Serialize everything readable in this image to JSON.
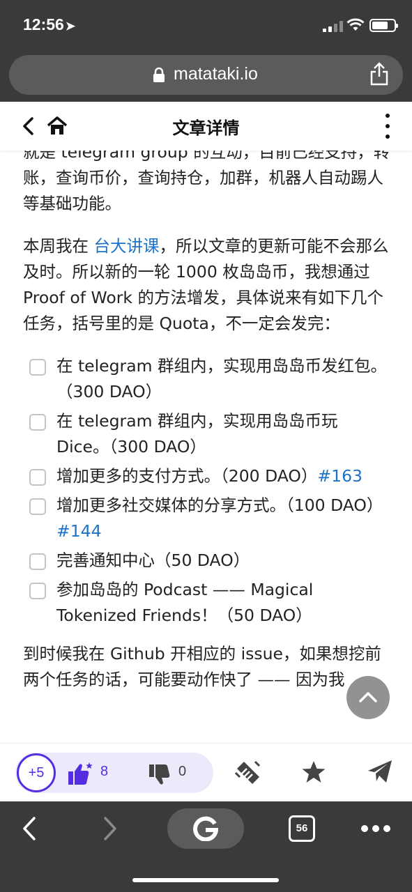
{
  "status_bar": {
    "time": "12:56",
    "location_arrow": "location-arrow-icon"
  },
  "browser": {
    "url": "matataki.io",
    "tab_count": "56",
    "search_engine_icon": "google-g-icon"
  },
  "header": {
    "title": "文章详情"
  },
  "article": {
    "p1": "就是 telegram group 的互动，目前已经支持，转账，查询币价，查询持仓，加群，机器人自动踢人等基础功能。",
    "p2_prefix": "本周我在 ",
    "p2_link": "台大讲课",
    "p2_suffix": "，所以文章的更新可能不会那么及时。所以新的一轮 1000 枚岛岛币，我想通过 Proof of Work 的方法增发，具体说来有如下几个任务，括号里的是 Quota，不一定会发完：",
    "tasks": [
      {
        "text": "在 telegram 群组内，实现用岛岛币发红包。（300 DAO）",
        "issue": ""
      },
      {
        "text": "在 telegram 群组内，实现用岛岛币玩 Dice。（300 DAO）",
        "issue": ""
      },
      {
        "text": "增加更多的支付方式。（200 DAO）",
        "issue": "#163"
      },
      {
        "text": "增加更多社交媒体的分享方式。（100 DAO）",
        "issue": "#144"
      },
      {
        "text": "完善通知中心（50 DAO）",
        "issue": ""
      },
      {
        "text": "参加岛岛的 Podcast —— Magical Tokenized Friends！（50 DAO）",
        "issue": ""
      }
    ],
    "p3": "到时候我在 Github 开相应的 issue，如果想挖前两个任务的话，可能要动作快了 —— 因为我"
  },
  "action_bar": {
    "plus_label": "+5",
    "like_count": "8",
    "dislike_count": "0"
  },
  "colors": {
    "accent": "#542de0",
    "link": "#1a73c8",
    "chrome": "#3a3a3c"
  }
}
